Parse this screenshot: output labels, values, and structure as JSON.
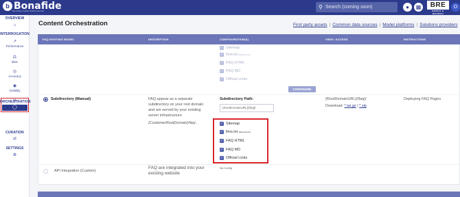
{
  "header": {
    "brand": "Bonafide",
    "brand_sub": "Bonafide Health Brand Partner",
    "search_placeholder": "Search (coming soon)",
    "bre_logo": "BRE",
    "bre_sub": "BENCH & BRANCH",
    "user_initial": "O"
  },
  "sidebar": {
    "overview": "OVERVIEW",
    "interrogation": "INTERROGATION",
    "items": [
      {
        "label": "Performance"
      },
      {
        "label": "Bias"
      },
      {
        "label": "Accuracy"
      },
      {
        "label": "Visibility"
      },
      {
        "label": "Perception"
      }
    ],
    "orchestration": "ORCHESTRATION",
    "curation": "CURATION",
    "settings": "SETTINGS"
  },
  "page": {
    "title": "Content Orchestration",
    "links": [
      "First party assets",
      "Common data sources",
      "Model platforms",
      "Solutions providers"
    ]
  },
  "table": {
    "headers": [
      "FAQ HOSTING MODEL",
      "DESCRIPTION",
      "CONFIGURATION(S)",
      "VIEW / ACCESS",
      "INSTRUCTIONS"
    ],
    "top_checks": [
      {
        "label": "Sitemap",
        "note": ""
      },
      {
        "label": "llms.txt",
        "note": "(Brand-level)"
      },
      {
        "label": "FAQ HTML",
        "note": ""
      },
      {
        "label": "FAQ MD",
        "note": ""
      },
      {
        "label": "Official Links",
        "note": ""
      }
    ],
    "configure_label": "CONFIGURE",
    "subdirectory": {
      "model": "Subdirectory (Manual)",
      "description_lines": [
        "FAQ appear as a separate",
        "subdirectory on your root domain",
        "and are served by your existing",
        "server infrastructure"
      ],
      "path_example": "{CustomerRootDomain}/faq/..",
      "config_label": "Subdirectory Path:",
      "path_value": "{RootDomainURL}/{faq}/",
      "view_path": "{RootDomainURL}/{faq}/",
      "download_label": "Download:",
      "download_tar": "*.tar.gz",
      "download_sep": "|",
      "download_zip": "*.zip",
      "instructions": "Deploying FAQ Pages",
      "checks": [
        {
          "label": "Sitemap",
          "note": ""
        },
        {
          "label": "llms.txt",
          "note": "(Brand-level)"
        },
        {
          "label": "FAQ HTML",
          "note": ""
        },
        {
          "label": "FAQ MD",
          "note": ""
        },
        {
          "label": "Official Links",
          "note": ""
        }
      ]
    },
    "api": {
      "model": "API Integration (Custom)",
      "description_lines": [
        "FAQ are integrated into your",
        "existing website"
      ],
      "config": "No Config"
    }
  },
  "colors": {
    "brand": "#2c3a8c",
    "table_header": "#6b76b8",
    "highlight": "#d8232a"
  }
}
